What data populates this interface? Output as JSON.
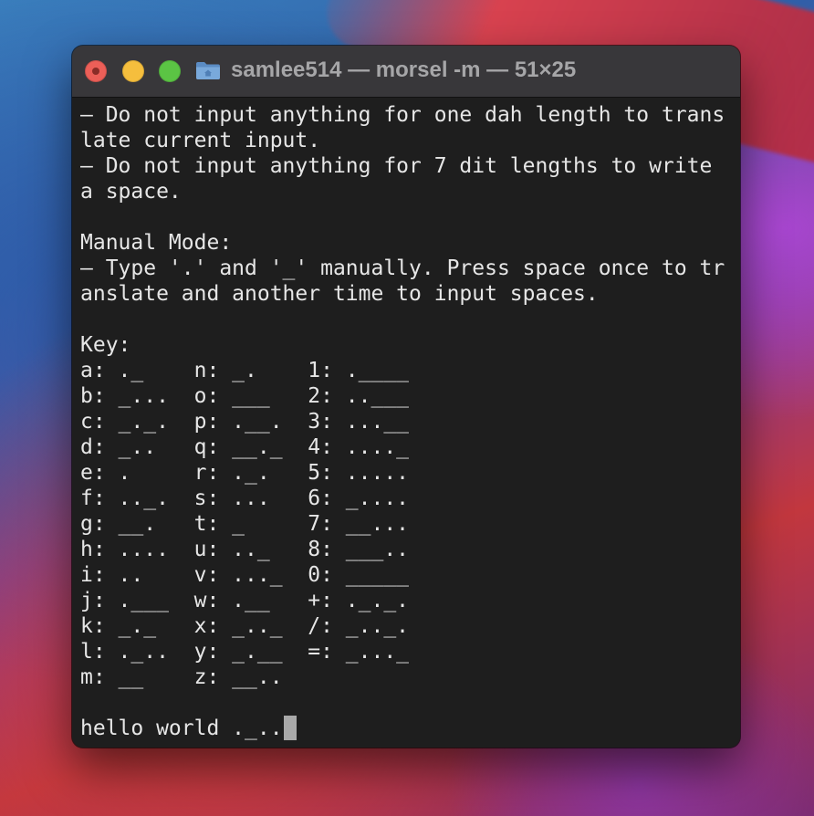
{
  "window": {
    "title": "samlee514 — morsel -m — 51×25"
  },
  "terminal": {
    "lines": [
      "– Do not input anything for one dah length to trans",
      "late current input.",
      "– Do not input anything for 7 dit lengths to write",
      "a space.",
      "",
      "Manual Mode:",
      "– Type '.' and '_' manually. Press space once to tr",
      "anslate and another time to input spaces.",
      "",
      "Key:",
      "a: ._    n: _.    1: .____",
      "b: _...  o: ___   2: ..___",
      "c: _._.  p: .__.  3: ...__",
      "d: _..   q: __._  4: ...._",
      "e: .     r: ._.   5: .....",
      "f: .._.  s: ...   6: _....",
      "g: __.   t: _     7: __...",
      "h: ....  u: .._   8: ___..",
      "i: ..    v: ..._  0: _____",
      "j: .___  w: .__   +: ._._.",
      "k: _._   x: _.._  /: _.._.",
      "l: ._..  y: _.__  =: _..._",
      "m: __    z: __..",
      ""
    ],
    "prompt_input": "hello world ._..",
    "cursor_color": "#a9a9a9",
    "text_color": "#e6e6e6",
    "background_color": "#1e1e1e"
  },
  "icons": {
    "close": "close-button",
    "minimize": "minimize-button",
    "maximize": "maximize-button",
    "folder": "folder-icon"
  }
}
